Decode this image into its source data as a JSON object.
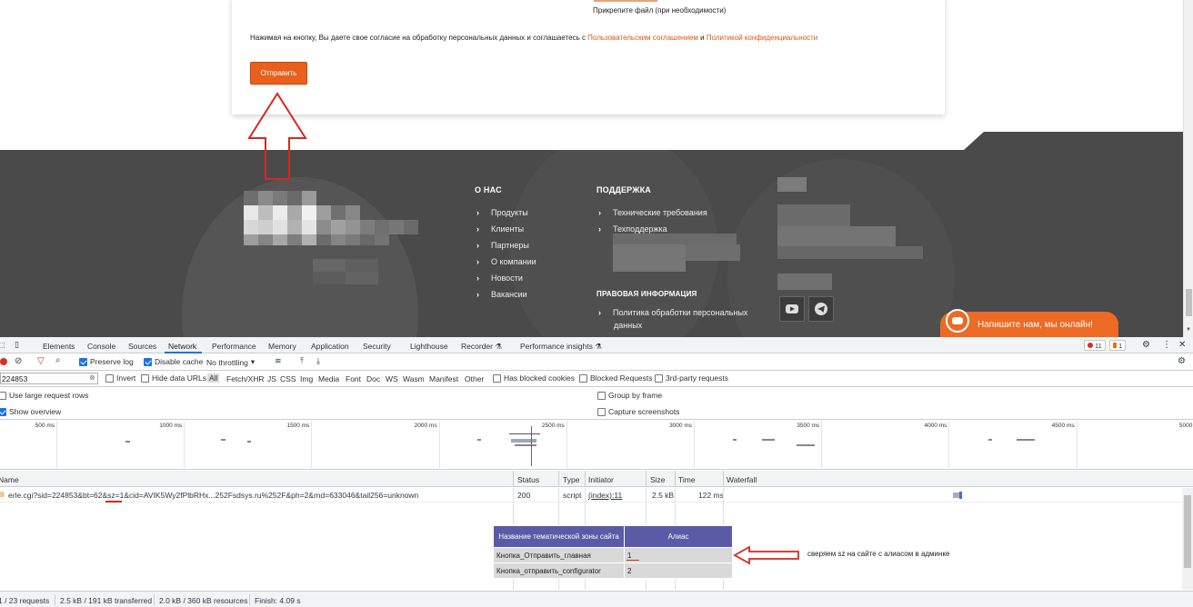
{
  "site": {
    "attach_note": "Прикрепите файл (при необходимости)",
    "consent_prefix": "Нажимая на кнопку, Вы даете свое согласие на обработку персональных данных и соглашаетесь с ",
    "consent_link1": "Пользовательским соглашением",
    "consent_mid": " и ",
    "consent_link2": "Политикой конфиденциальности",
    "submit_label": "Отправить",
    "footer": {
      "about_title": "О НАС",
      "about_links": [
        "Продукты",
        "Клиенты",
        "Партнеры",
        "О компании",
        "Новости",
        "Вакансии"
      ],
      "support_title": "ПОДДЕРЖКА",
      "support_links": [
        "Технические требования",
        "Техподдержка"
      ],
      "legal_title": "ПРАВОВАЯ ИНФОРМАЦИЯ",
      "legal_link_line1": "Политика обработки персональных",
      "legal_link_line2": "данных"
    },
    "chat_label": "Напишите нам, мы онлайн!"
  },
  "devtools": {
    "tabs": [
      "Elements",
      "Console",
      "Sources",
      "Network",
      "Performance",
      "Memory",
      "Application",
      "Security",
      "Lighthouse",
      "Recorder",
      "Performance insights"
    ],
    "active_tab": "Network",
    "errors_count": "11",
    "warnings_count": "1",
    "toolbar": {
      "preserve_log": "Preserve log",
      "disable_cache": "Disable cache",
      "throttling": "No throttling"
    },
    "filter": {
      "value": "224853",
      "invert": "Invert",
      "hide_data_urls": "Hide data URLs",
      "types": [
        "All",
        "Fetch/XHR",
        "JS",
        "CSS",
        "Img",
        "Media",
        "Font",
        "Doc",
        "WS",
        "Wasm",
        "Manifest",
        "Other"
      ],
      "has_blocked_cookies": "Has blocked cookies",
      "blocked_requests": "Blocked Requests",
      "third_party": "3rd-party requests"
    },
    "options": {
      "large_rows": "Use large request rows",
      "group_by_frame": "Group by frame",
      "show_overview": "Show overview",
      "capture_screenshots": "Capture screenshots"
    },
    "overview_ticks": [
      "500 ms",
      "1000 ms",
      "1500 ms",
      "2000 ms",
      "2500 ms",
      "3000 ms",
      "3500 ms",
      "4000 ms",
      "4500 ms",
      "5000 ms",
      "5500 ms",
      "6000 ms",
      "6500 ms",
      "7000 ms",
      "7500 ms",
      "8000 ms",
      "8500 ms",
      "9000 ms",
      "950"
    ],
    "columns": {
      "name": "Name",
      "status": "Status",
      "type": "Type",
      "initiator": "Initiator",
      "size": "Size",
      "time": "Time",
      "waterfall": "Waterfall"
    },
    "request": {
      "name": "erle.cgi?sid=224853&bt=62&sz=1&cid=AVIK5Wy2fPlbRHx...252Fsdsys.ru%252F&ph=2&rnd=633046&tail256=unknown",
      "status": "200",
      "type": "script",
      "initiator": "(index):11",
      "size": "2.5 kB",
      "time": "122 ms"
    },
    "status_bar": {
      "requests": "1 / 23 requests",
      "transferred": "2.5 kB / 191 kB transferred",
      "resources": "2.0 kB / 360 kB resources",
      "finish": "Finish: 4.09 s"
    }
  },
  "admin_table": {
    "headers": [
      "Название тематической зоны сайта",
      "Алиас"
    ],
    "rows": [
      [
        "Кнопка_Отправить_главная",
        "1"
      ],
      [
        "Кнопка_отправить_configurator",
        "2"
      ]
    ]
  },
  "annotation": "сверяем sz на сайте с алиасом в админке",
  "colors": {
    "accent_orange": "#e8601c",
    "footer_bg": "#4a4a4a",
    "annotation_red": "#d7281e",
    "table_header": "#5b5aa6",
    "devtools_blue": "#1a73e8"
  }
}
